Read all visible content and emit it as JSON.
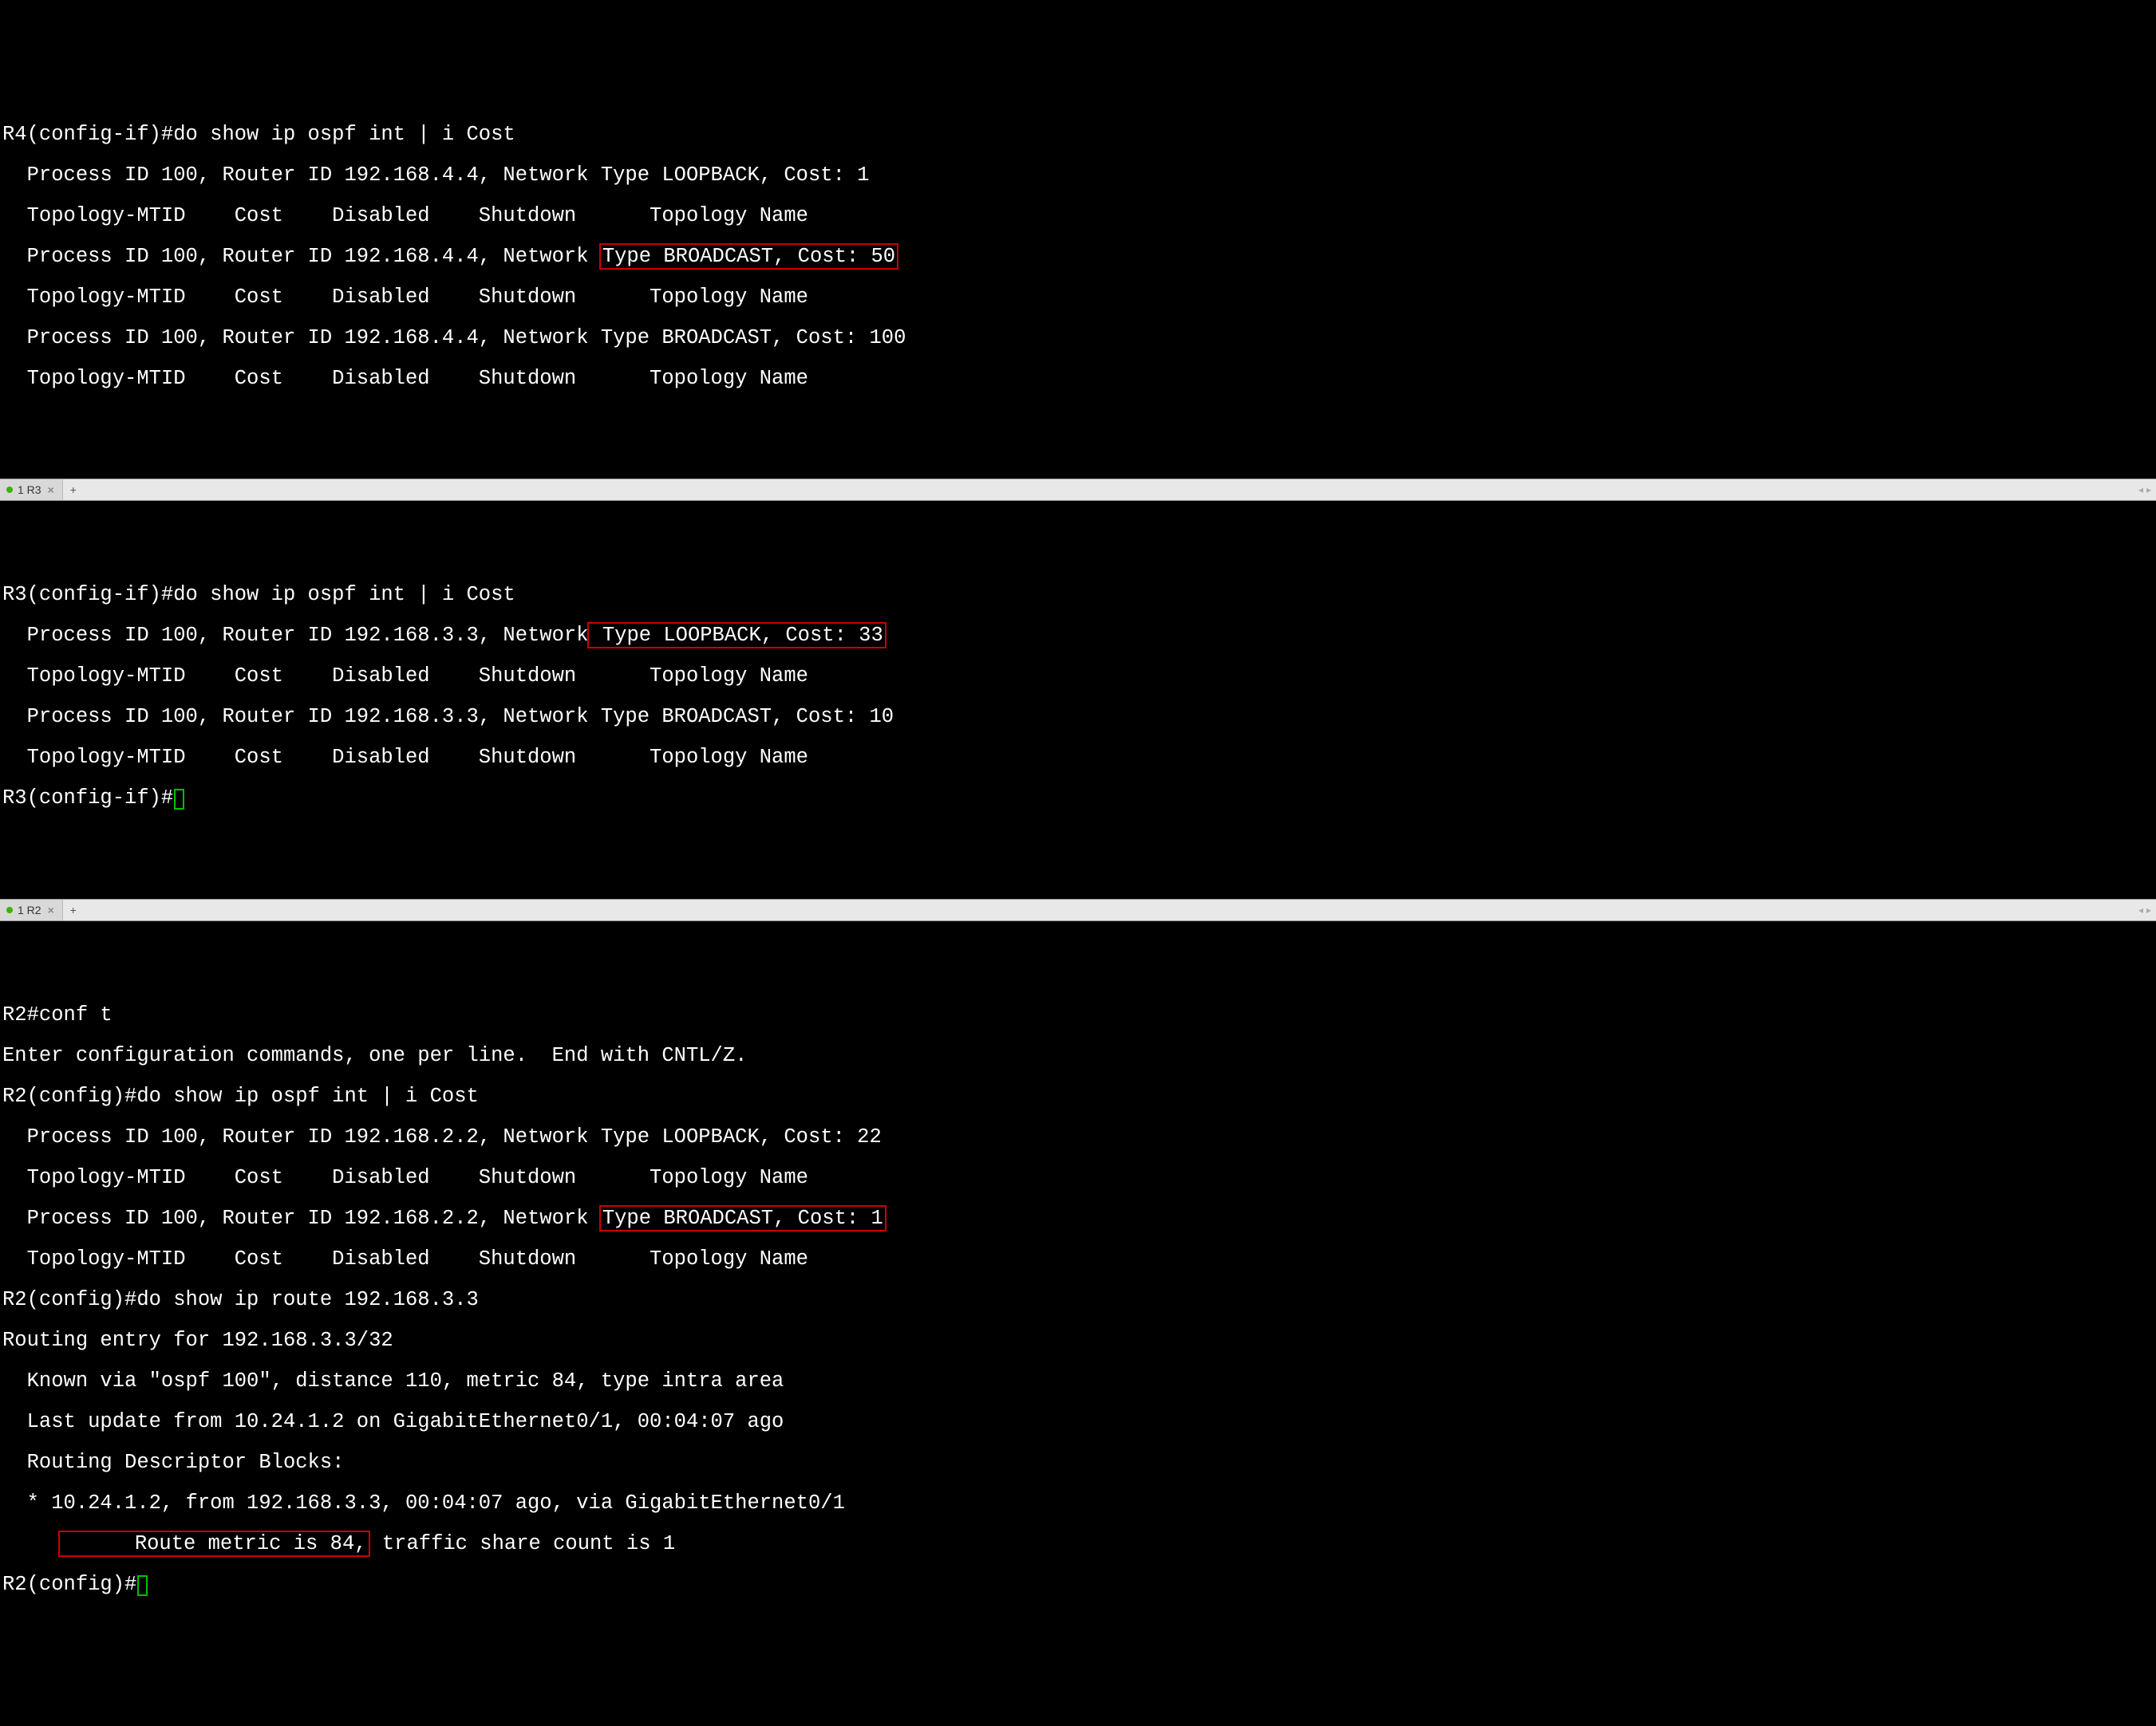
{
  "r4": {
    "prompt1": "R4(config-if)#do show ip ospf int | i Cost",
    "l2": "  Process ID 100, Router ID 192.168.4.4, Network Type LOOPBACK, Cost: 1",
    "l3": "  Topology-MTID    Cost    Disabled    Shutdown      Topology Name",
    "l4a": "  Process ID 100, Router ID 192.168.4.4, Network ",
    "l4b": "Type BROADCAST, Cost: 50",
    "l5": "  Topology-MTID    Cost    Disabled    Shutdown      Topology Name",
    "l6": "  Process ID 100, Router ID 192.168.4.4, Network Type BROADCAST, Cost: 100",
    "l7": "  Topology-MTID    Cost    Disabled    Shutdown      Topology Name"
  },
  "tab_r3": {
    "label": "1 R3"
  },
  "r3": {
    "prompt1": "R3(config-if)#do show ip ospf int | i Cost",
    "l2a": "  Process ID 100, Router ID 192.168.3.3, Network",
    "l2b": " Type LOOPBACK, Cost: 33",
    "l3": "  Topology-MTID    Cost    Disabled    Shutdown      Topology Name",
    "l4": "  Process ID 100, Router ID 192.168.3.3, Network Type BROADCAST, Cost: 10",
    "l5": "  Topology-MTID    Cost    Disabled    Shutdown      Topology Name",
    "prompt2": "R3(config-if)#"
  },
  "tab_r2": {
    "label": "1 R2"
  },
  "r2": {
    "p1": "R2#conf t",
    "p2": "Enter configuration commands, one per line.  End with CNTL/Z.",
    "p3": "R2(config)#do show ip ospf int | i Cost",
    "l4": "  Process ID 100, Router ID 192.168.2.2, Network Type LOOPBACK, Cost: 22",
    "l5": "  Topology-MTID    Cost    Disabled    Shutdown      Topology Name",
    "l6a": "  Process ID 100, Router ID 192.168.2.2, Network ",
    "l6b": "Type BROADCAST, Cost: 1",
    "l7": "  Topology-MTID    Cost    Disabled    Shutdown      Topology Name",
    "p8": "R2(config)#do show ip route 192.168.3.3",
    "p9": "Routing entry for 192.168.3.3/32",
    "p10": "  Known via \"ospf 100\", distance 110, metric 84, type intra area",
    "p11": "  Last update from 10.24.1.2 on GigabitEthernet0/1, 00:04:07 ago",
    "p12": "  Routing Descriptor Blocks:",
    "p13": "  * 10.24.1.2, from 192.168.3.3, 00:04:07 ago, via GigabitEthernet0/1",
    "p14a": "      Route metric is 84,",
    "p14b": " traffic share count is 1",
    "prompt": "R2(config)#"
  },
  "icons": {
    "close": "×",
    "plus": "+",
    "left": "◂",
    "right": "▸"
  }
}
